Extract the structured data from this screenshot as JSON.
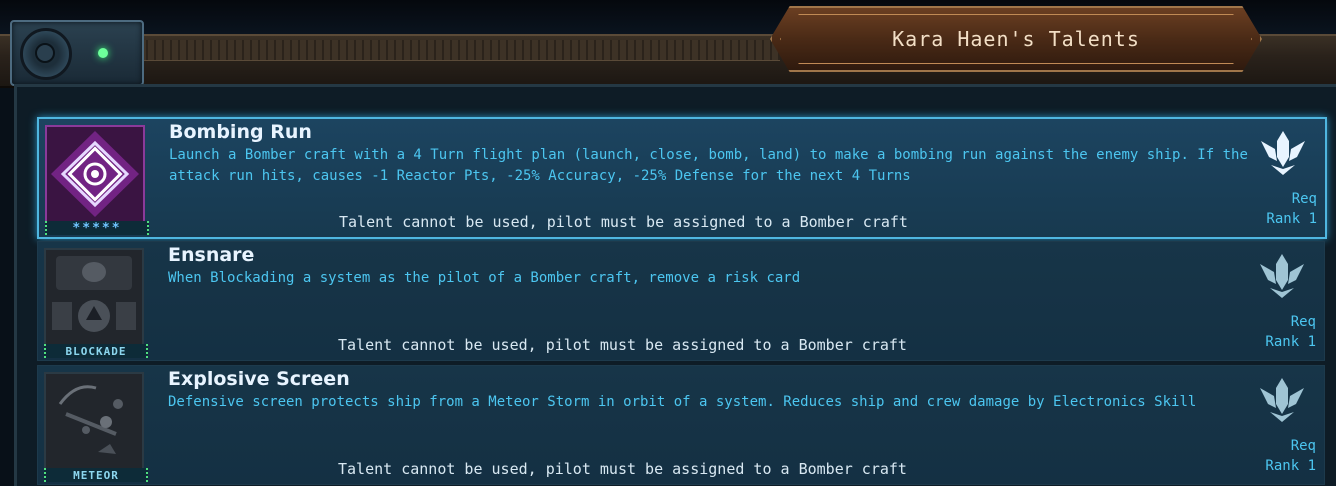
{
  "window": {
    "title": "Kara Haen's Talents"
  },
  "talents": [
    {
      "name": "Bombing Run",
      "description": "Launch a Bomber craft with a 4 Turn flight plan (launch, close, bomb, land) to make a bombing run against the enemy ship. If the attack run hits, causes -1 Reactor Pts, -25% Accuracy, -25% Defense for the next 4 Turns",
      "status": "Talent cannot be used, pilot must be assigned to a Bomber craft",
      "icon_label": "*****",
      "icon": "bomber-talent-icon",
      "req_label": "Req",
      "rank_label": "Rank 1",
      "selected": true
    },
    {
      "name": "Ensnare",
      "description": "When Blockading a system as the pilot of a Bomber craft, remove a risk card",
      "status": "Talent cannot be used, pilot must be assigned to a Bomber craft",
      "icon_label": "BLOCKADE",
      "icon": "blockade-icon",
      "req_label": "Req",
      "rank_label": "Rank 1",
      "selected": false
    },
    {
      "name": "Explosive Screen",
      "description": "Defensive screen protects ship from a Meteor Storm in orbit of a system. Reduces ship and crew damage by Electronics Skill",
      "status": "Talent cannot be used, pilot must be assigned to a Bomber craft",
      "icon_label": "METEOR",
      "icon": "meteor-icon",
      "req_label": "Req",
      "rank_label": "Rank 1",
      "selected": false
    }
  ],
  "colors": {
    "accent": "#4cc6f0",
    "selected_border": "#4fb6e0",
    "title_plate": "#6b3f22"
  }
}
